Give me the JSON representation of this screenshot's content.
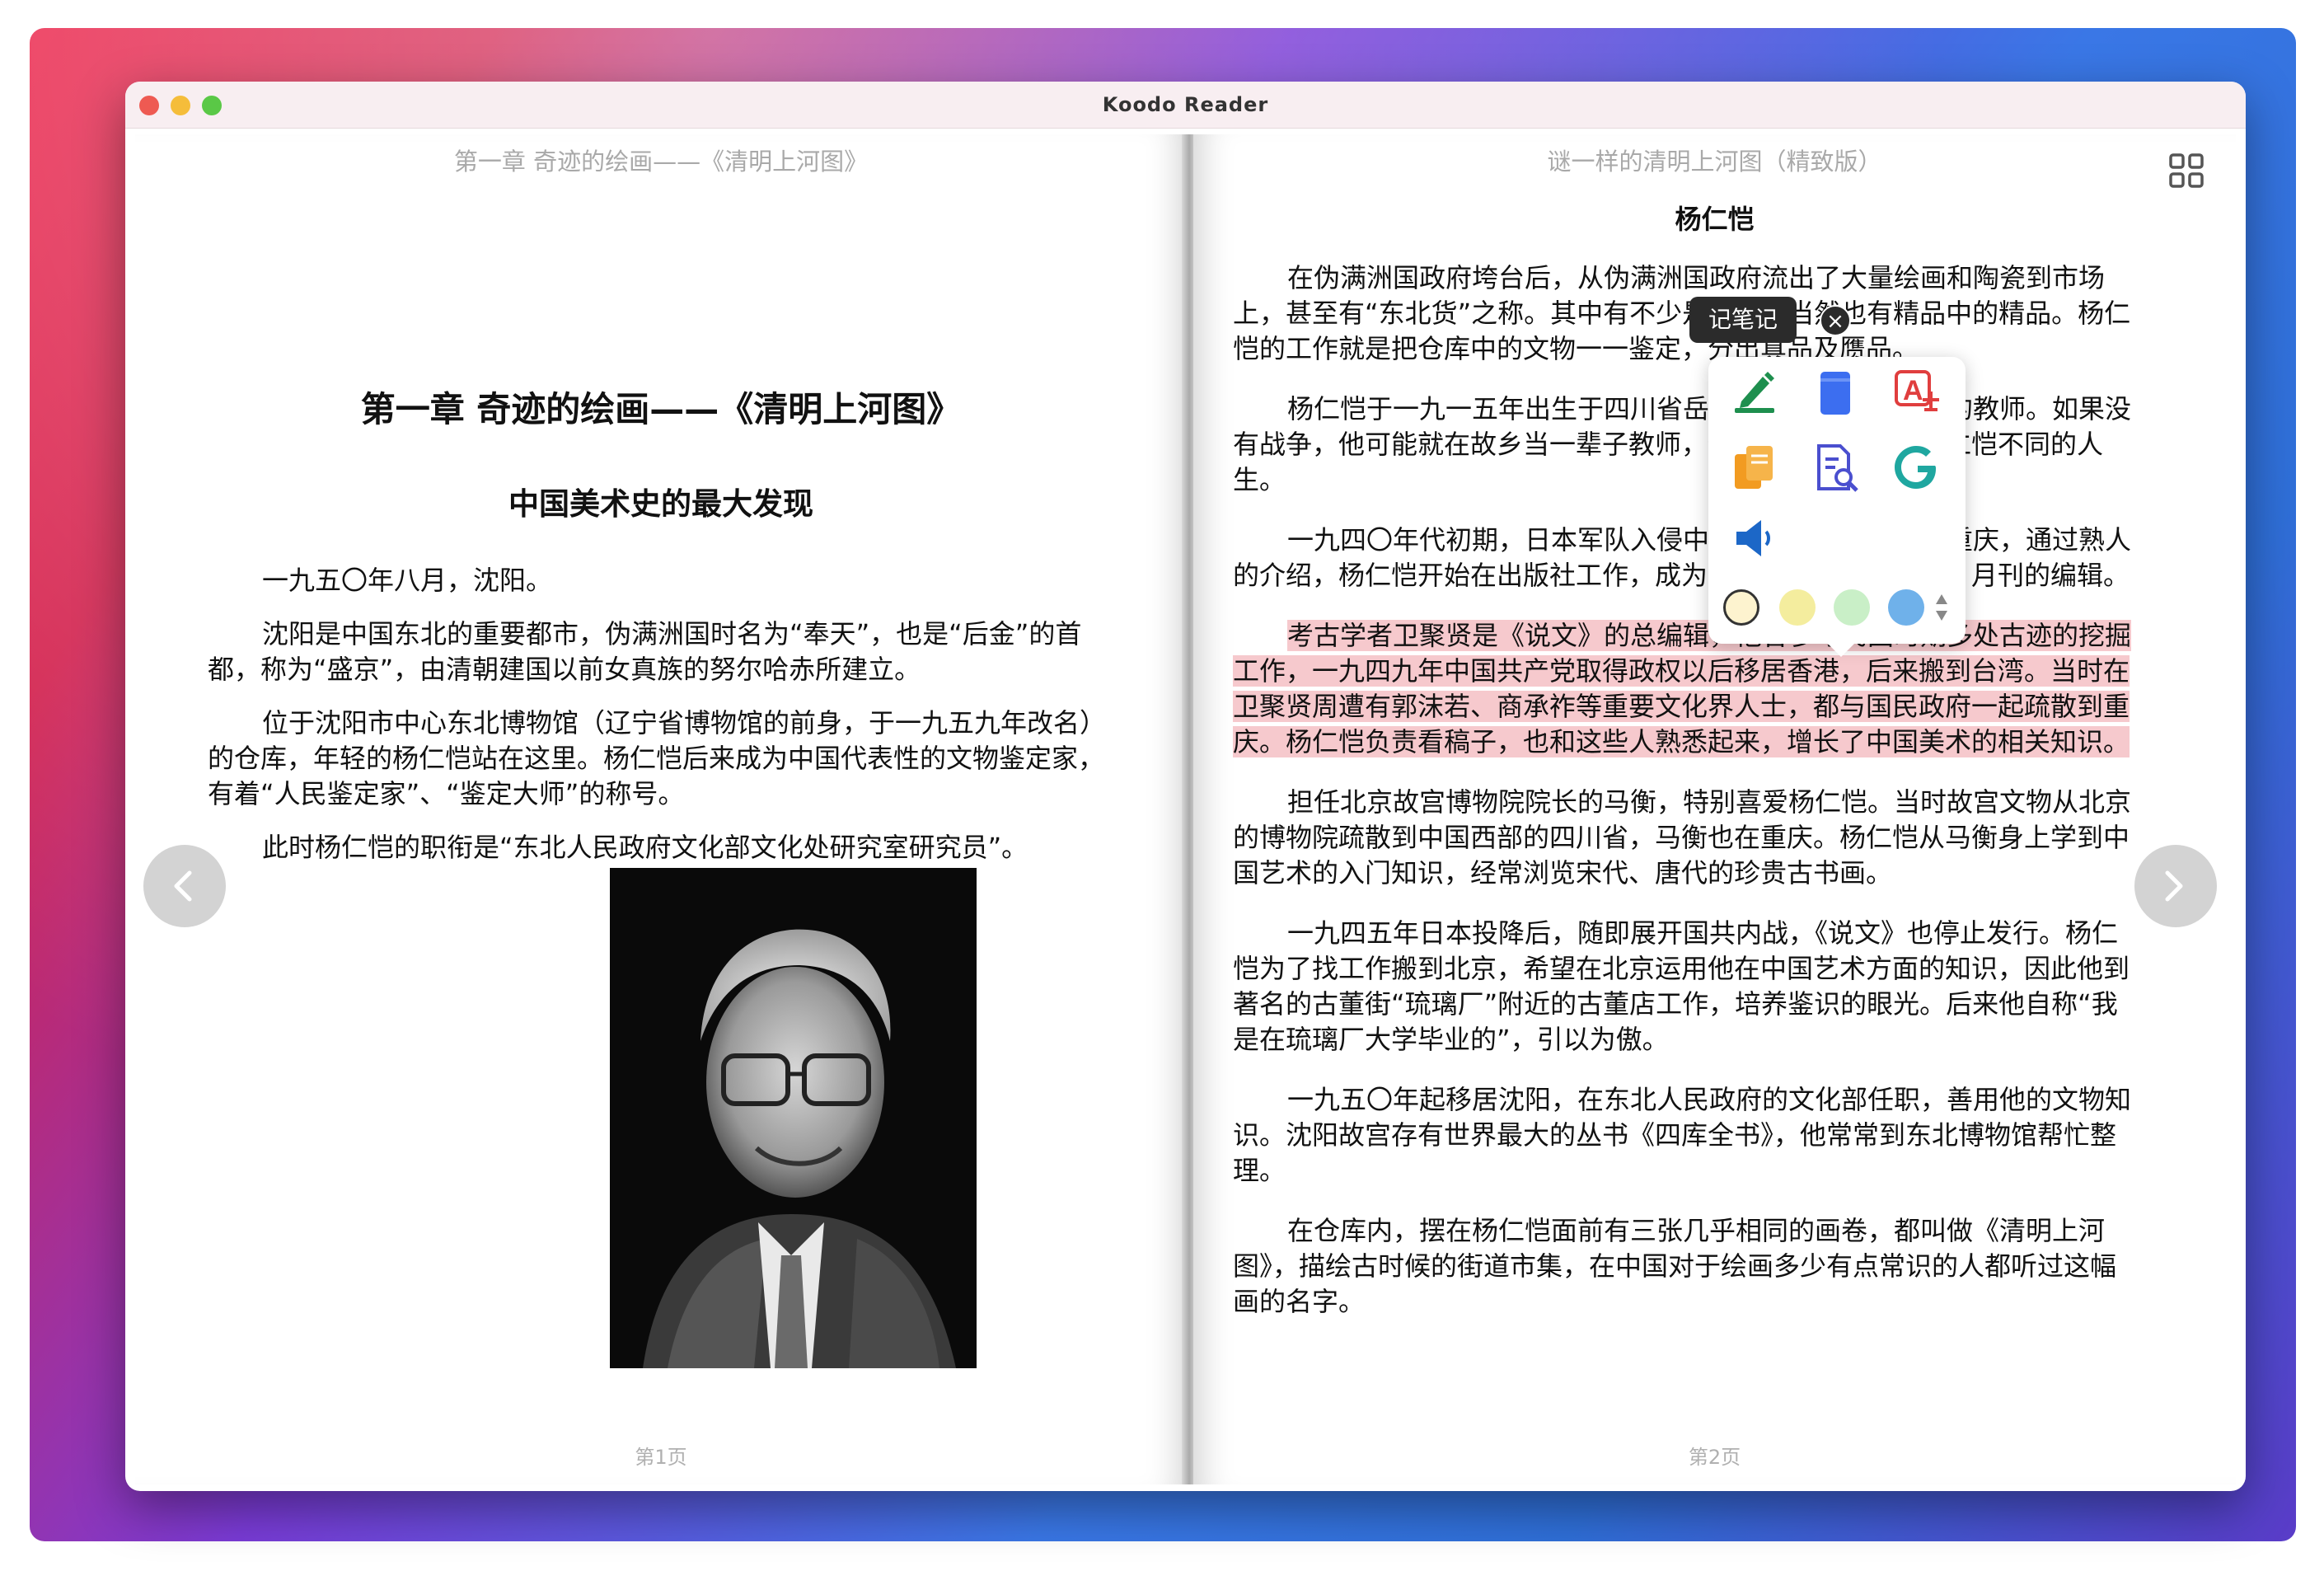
{
  "app": {
    "title": "Koodo Reader"
  },
  "left_page": {
    "header": "第一章 奇迹的绘画——《清明上河图》",
    "chapter_title": "第一章 奇迹的绘画——《清明上河图》",
    "section_title": "中国美术史的最大发现",
    "paragraphs": [
      "一九五〇年八月，沈阳。",
      "沈阳是中国东北的重要都市，伪满洲国时名为“奉天”，也是“后金”的首都，称为“盛京”，由清朝建国以前女真族的努尔哈赤所建立。",
      "位于沈阳市中心东北博物馆（辽宁省博物馆的前身，于一九五九年改名）的仓库，年轻的杨仁恺站在这里。杨仁恺后来成为中国代表性的文物鉴定家，有着“人民鉴定家”、“鉴定大师”的称号。",
      "此时杨仁恺的职衔是“东北人民政府文化部文化处研究室研究员”。"
    ],
    "footer": "第1页"
  },
  "right_page": {
    "header": "谜一样的清明上河图（精致版）",
    "title": "杨仁恺",
    "paragraphs": [
      "在伪满洲国政府垮台后，从伪满洲国政府流出了大量绘画和陶瓷到市场上，甚至有“东北货”之称。其中有不少是仿本，当然也有精品中的精品。杨仁恺的工作就是把仓库中的文物一一鉴定，分出真品及赝品。",
      "杨仁恺于一九一五年出生于四川省岳池县，这是个小地方的教师。如果没有战争，他可能就在故乡当一辈子教师，但动荡的历史给了杨仁恺不同的人生。",
      "一九四〇年代初期，日本军队入侵中国，国民政府迁移到重庆，通过熟人的介绍，杨仁恺开始在出版社工作，成为大型文艺杂志《说文》月刊的编辑。",
      "考古学者卫聚贤是《说文》的总编辑，他曾参与民国时期多处古迹的挖掘工作，一九四九年中国共产党取得政权以后移居香港，后来搬到台湾。当时在卫聚贤周遭有郭沫若、商承祚等重要文化界人士，都与国民政府一起疏散到重庆。杨仁恺负责看稿子，也和这些人熟悉起来，增长了中国美术的相关知识。",
      "担任北京故宫博物院院长的马衡，特别喜爱杨仁恺。当时故宫文物从北京的博物院疏散到中国西部的四川省，马衡也在重庆。杨仁恺从马衡身上学到中国艺术的入门知识，经常浏览宋代、唐代的珍贵古书画。",
      "一九四五年日本投降后，随即展开国共内战，《说文》也停止发行。杨仁恺为了找工作搬到北京，希望在北京运用他在中国艺术方面的知识，因此他到著名的古董街“琉璃厂”附近的古董店工作，培养鉴识的眼光。后来他自称“我是在琉璃厂大学毕业的”，引以为傲。",
      "一九五〇年起移居沈阳，在东北人民政府的文化部任职，善用他的文物知识。沈阳故宫存有世界最大的丛书《四库全书》，他常常到东北博物馆帮忙整理。",
      "在仓库内，摆在杨仁恺面前有三张几乎相同的画卷，都叫做《清明上河图》，描绘古时候的街道市集，在中国对于绘画多少有点常识的人都听过这幅画的名字。"
    ],
    "footer": "第2页"
  },
  "selection_popup": {
    "tooltip": "记笔记",
    "close": "×",
    "actions": [
      "note-icon",
      "bookmark-icon",
      "translate-icon",
      "copy-icon",
      "search-icon",
      "google-icon",
      "speak-icon"
    ],
    "colors": [
      "#fdf3cf",
      "#f4ed9e",
      "#c9efc7",
      "#6fb1ea"
    ]
  },
  "colors": {
    "highlight": "#f6c9cd",
    "accent_green": "#1e8f4e"
  }
}
